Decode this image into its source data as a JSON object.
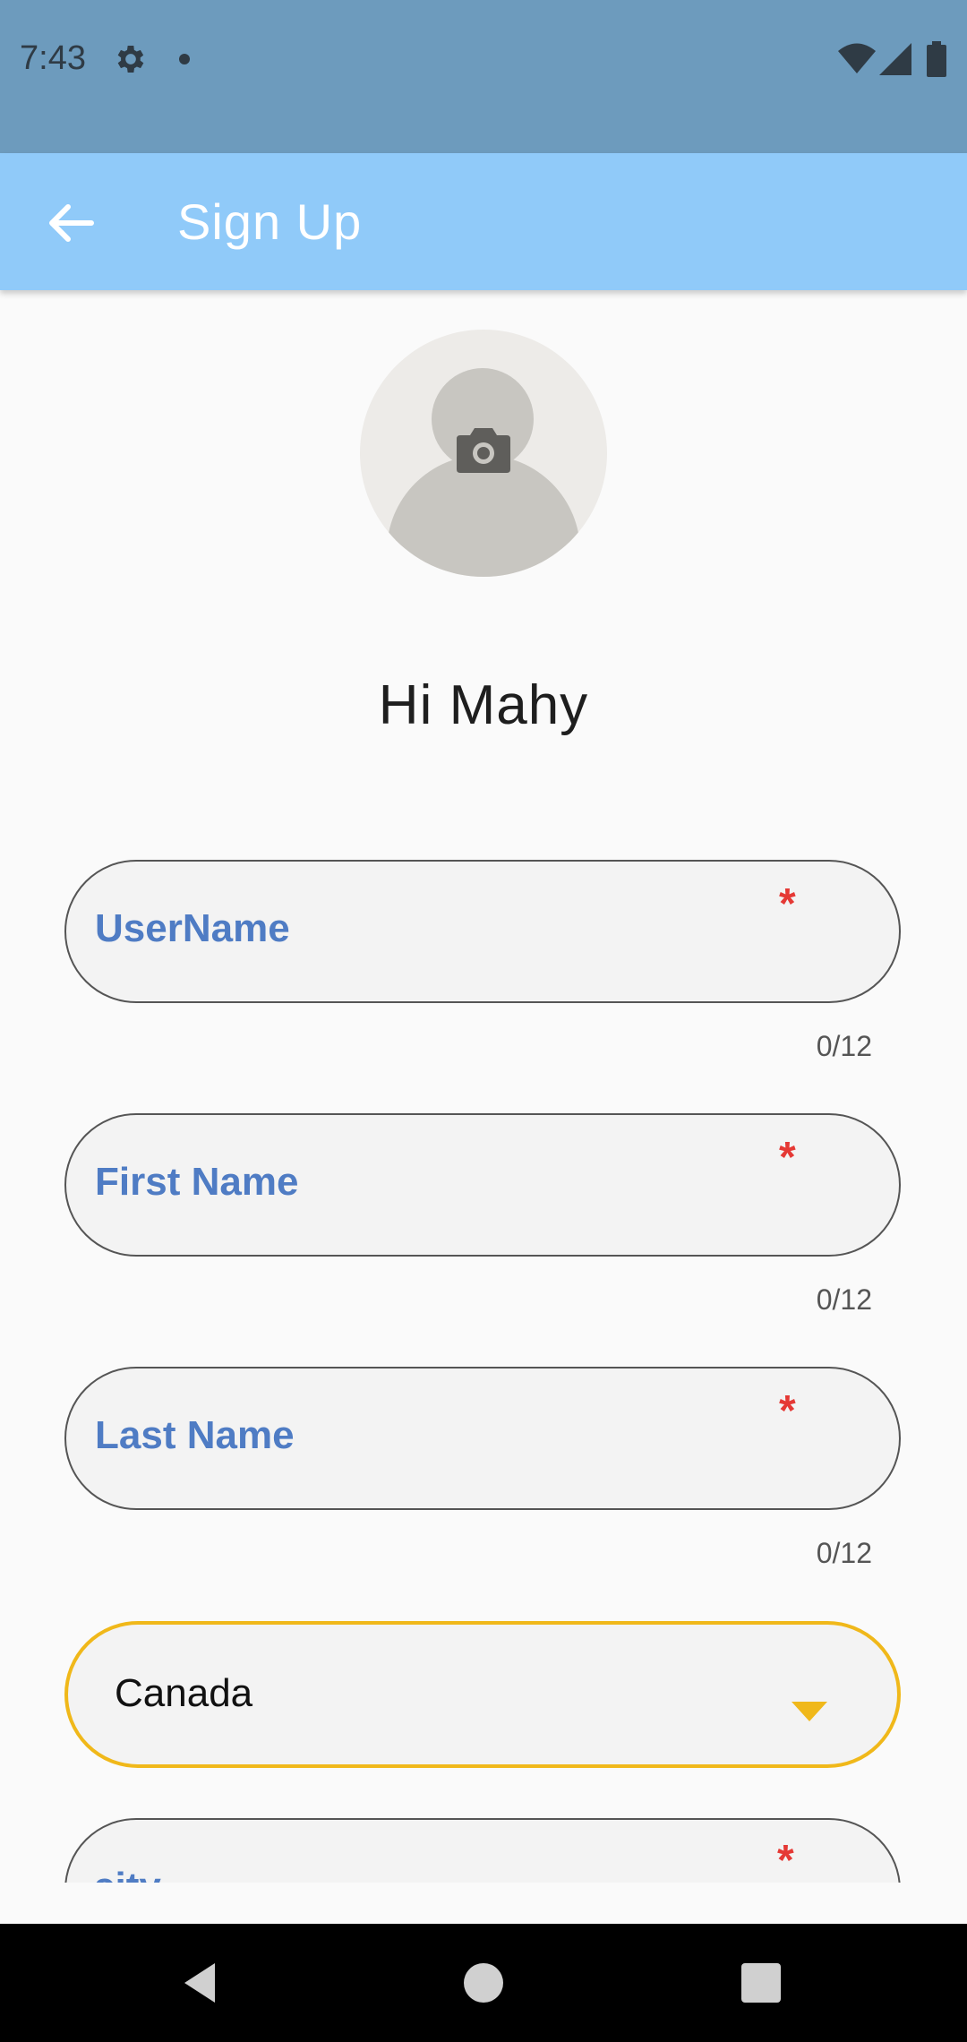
{
  "status_bar": {
    "time": "7:43",
    "icons": [
      "gear-icon",
      "dot-icon",
      "wifi-icon",
      "signal-icon",
      "battery-icon"
    ]
  },
  "app_bar": {
    "title": "Sign Up",
    "back_icon": "arrow-left-icon",
    "color": "#90caf9"
  },
  "profile": {
    "avatar_icon": "person-placeholder",
    "camera_icon": "camera-icon",
    "greeting": "Hi Mahy"
  },
  "form": {
    "fields": [
      {
        "label": "UserName",
        "required": "*",
        "counter": "0/12"
      },
      {
        "label": "First Name",
        "required": "*",
        "counter": "0/12"
      },
      {
        "label": "Last Name",
        "required": "*",
        "counter": "0/12"
      }
    ],
    "country": {
      "value": "Canada"
    },
    "partial_field": {
      "label": "city",
      "required": "*"
    }
  },
  "colors": {
    "label": "#4f7cc4",
    "required": "#e53935",
    "dropdown_border": "#f0b81a",
    "status_bar": "#6d9bbd"
  },
  "nav_bar": {
    "icons": [
      "back-triangle-icon",
      "home-circle-icon",
      "recents-square-icon"
    ]
  }
}
